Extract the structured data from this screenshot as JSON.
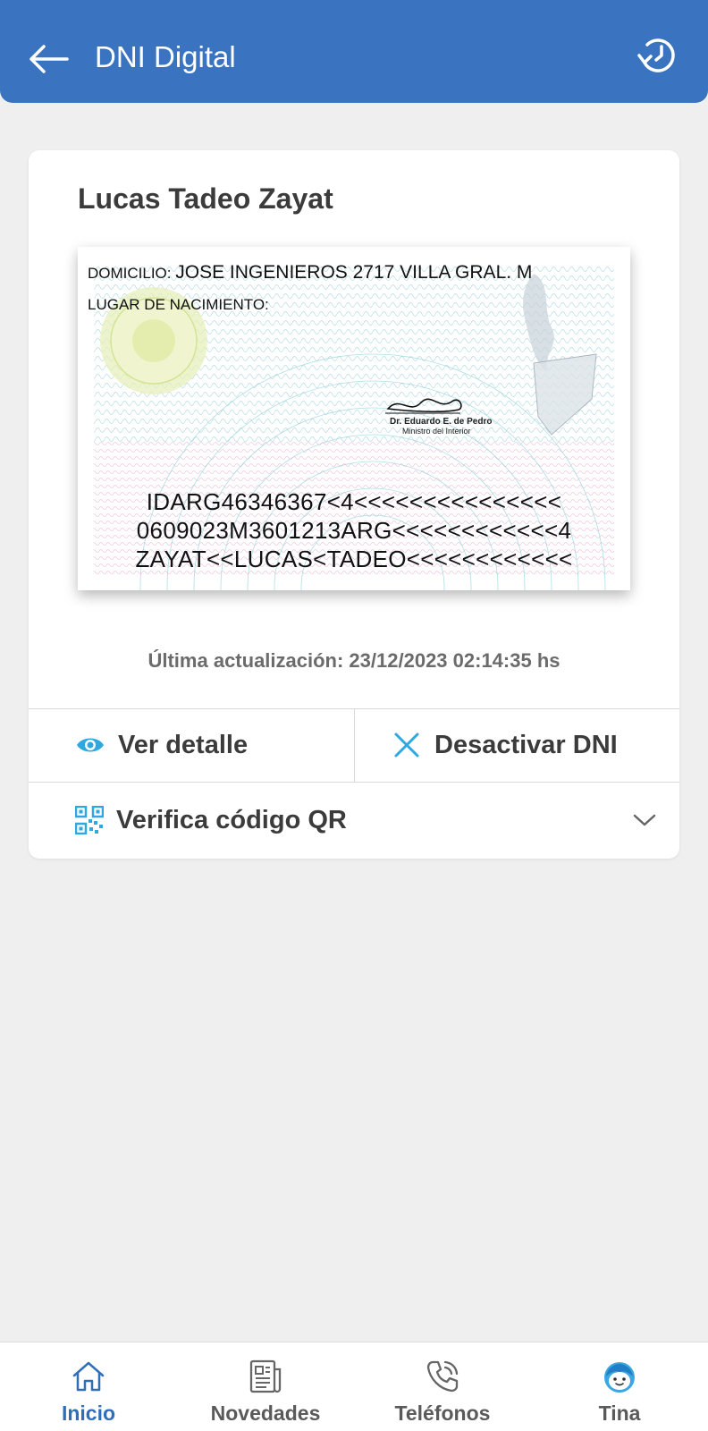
{
  "colors": {
    "primary": "#3a73bf",
    "accent": "#2fa8e0",
    "background": "#efefef"
  },
  "header": {
    "title": "DNI Digital",
    "back_icon": "arrow-left-icon",
    "refresh_icon": "refresh-clock-icon"
  },
  "card": {
    "holder_name": "Lucas Tadeo Zayat",
    "dni_back": {
      "domicilio_label": "DOMICILIO:",
      "domicilio_value": "JOSE INGENIEROS 2717 VILLA GRAL. M",
      "nacimiento_label": "LUGAR DE NACIMIENTO:",
      "signatory_name": "Dr. Eduardo E. de Pedro",
      "signatory_role": "Ministro del Interior",
      "mrz": [
        "IDARG46346367<4<<<<<<<<<<<<<<<",
        "0609023M3601213ARG<<<<<<<<<<<<4",
        "ZAYAT<<LUCAS<TADEO<<<<<<<<<<<<"
      ]
    },
    "last_update": "Última actualización: 23/12/2023 02:14:35 hs",
    "actions": {
      "view_detail": "Ver detalle",
      "deactivate": "Desactivar DNI",
      "verify_qr": "Verifica código QR"
    }
  },
  "bottom_nav": {
    "items": [
      {
        "label": "Inicio",
        "icon": "home-icon",
        "active": true
      },
      {
        "label": "Novedades",
        "icon": "newspaper-icon",
        "active": false
      },
      {
        "label": "Teléfonos",
        "icon": "phone-icon",
        "active": false
      },
      {
        "label": "Tina",
        "icon": "tina-face-icon",
        "active": false
      }
    ]
  }
}
